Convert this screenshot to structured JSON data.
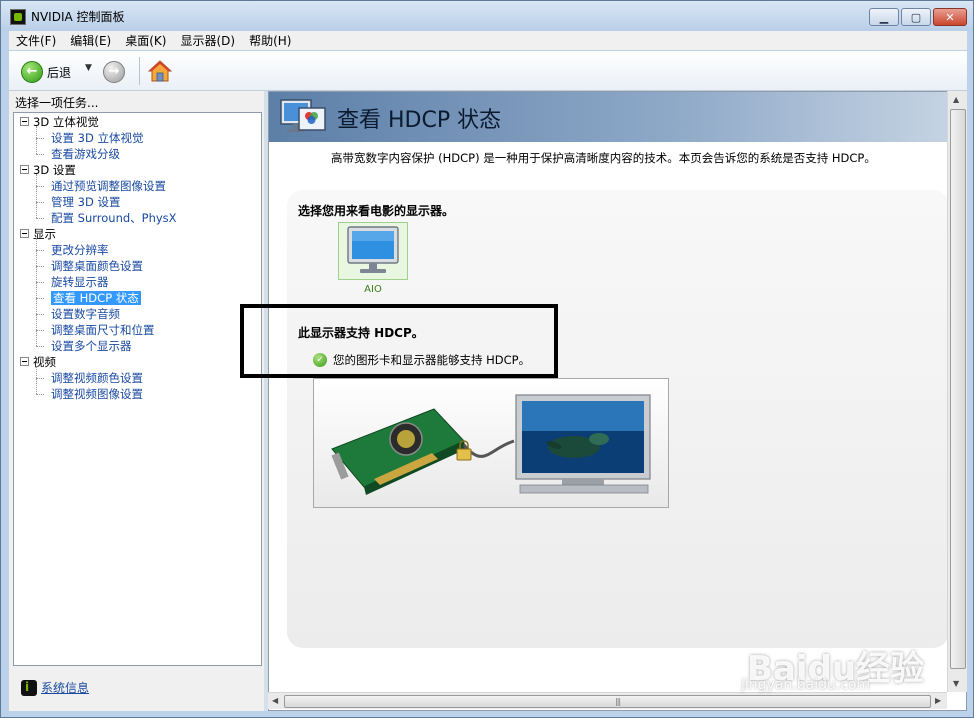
{
  "window": {
    "title": "NVIDIA 控制面板"
  },
  "menubar": {
    "items": [
      "文件(F)",
      "编辑(E)",
      "桌面(K)",
      "显示器(D)",
      "帮助(H)"
    ]
  },
  "toolbar": {
    "back_label": "后退"
  },
  "sidebar": {
    "header": "选择一项任务...",
    "sysinfo_label": "系统信息",
    "tree": [
      {
        "kind": "cat",
        "label": "3D 立体视觉"
      },
      {
        "kind": "child",
        "label": "设置 3D 立体视觉"
      },
      {
        "kind": "child",
        "label": "查看游戏分级"
      },
      {
        "kind": "cat",
        "label": "3D 设置"
      },
      {
        "kind": "child",
        "label": "通过预览调整图像设置"
      },
      {
        "kind": "child",
        "label": "管理 3D 设置"
      },
      {
        "kind": "child",
        "label": "配置 Surround、PhysX"
      },
      {
        "kind": "cat",
        "label": "显示"
      },
      {
        "kind": "child",
        "label": "更改分辨率"
      },
      {
        "kind": "child",
        "label": "调整桌面颜色设置"
      },
      {
        "kind": "child",
        "label": "旋转显示器"
      },
      {
        "kind": "child",
        "label": "查看 HDCP 状态",
        "selected": true
      },
      {
        "kind": "child",
        "label": "设置数字音频"
      },
      {
        "kind": "child",
        "label": "调整桌面尺寸和位置"
      },
      {
        "kind": "child",
        "label": "设置多个显示器"
      },
      {
        "kind": "cat",
        "label": "视频"
      },
      {
        "kind": "child",
        "label": "调整视频颜色设置"
      },
      {
        "kind": "child",
        "label": "调整视频图像设置"
      }
    ]
  },
  "main": {
    "title": "查看 HDCP 状态",
    "description": "高带宽数字内容保护 (HDCP) 是一种用于保护高清晰度内容的技术。本页会告诉您的系统是否支持 HDCP。",
    "select_label": "选择您用来看电影的显示器。",
    "monitor_name": "AIO",
    "support_label": "此显示器支持 HDCP。",
    "status_text": "您的图形卡和显示器能够支持 HDCP。"
  },
  "watermark": {
    "brand": "Baidu经验",
    "url": "jingyan.baidu.com"
  },
  "colors": {
    "accent": "#3399ff",
    "nvidia_green": "#76b900",
    "link": "#1a4aa0",
    "highlight_border": "#000000"
  }
}
